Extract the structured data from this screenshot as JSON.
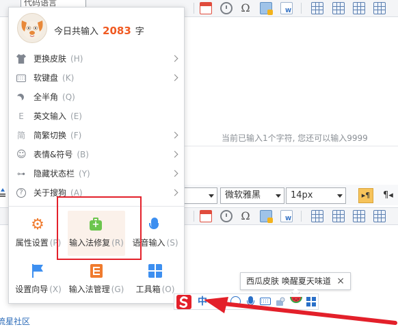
{
  "editor": {
    "top_tab_label": "代码语言",
    "char_count_text": "当前已输入1个字符, 您还可以输入9999",
    "font_family": "微软雅黑",
    "font_size": "14px",
    "bottom_link": "流星社区"
  },
  "ime_menu": {
    "header": {
      "prefix": "今日共输入",
      "count": "2083",
      "suffix": "字"
    },
    "items": [
      {
        "label": "更换皮肤",
        "key": "(H)",
        "icon": "tshirt-icon",
        "submenu": true
      },
      {
        "label": "软键盘",
        "key": "(K)",
        "icon": "keyboard-icon",
        "submenu": true
      },
      {
        "label": "全半角",
        "key": "(Q)",
        "icon": "moon-icon",
        "submenu": false
      },
      {
        "label": "英文输入",
        "key": "(E)",
        "icon": "english-icon",
        "glyph": "E",
        "submenu": false
      },
      {
        "label": "简繁切换",
        "key": "(F)",
        "icon": "simplified-traditional-icon",
        "glyph": "简",
        "submenu": true
      },
      {
        "label": "表情&符号",
        "key": "(B)",
        "icon": "smiley-icon",
        "glyph": "☺",
        "submenu": true
      },
      {
        "label": "隐藏状态栏",
        "key": "(Y)",
        "icon": "hide-statusbar-icon",
        "glyph": "⊶",
        "submenu": true
      },
      {
        "label": "关于搜狗",
        "key": "(A)",
        "icon": "help-icon",
        "glyph": "?",
        "submenu": true
      }
    ],
    "tiles": [
      {
        "label": "属性设置",
        "key": "(P)",
        "icon": "gear-icon"
      },
      {
        "label": "输入法修复",
        "key": "(R)",
        "icon": "repair-briefcase-icon"
      },
      {
        "label": "语音输入",
        "key": "(S)",
        "icon": "microphone-icon"
      },
      {
        "label": "设置向导",
        "key": "(X)",
        "icon": "flag-icon"
      },
      {
        "label": "输入法管理",
        "key": "(G)",
        "icon": "manage-icon"
      },
      {
        "label": "工具箱",
        "key": "(O)",
        "icon": "toolbox-icon"
      }
    ]
  },
  "status_bar": {
    "mode": "中",
    "punct": "•,"
  },
  "tooltip": {
    "text": "西瓜皮肤 唤醒夏天味道",
    "close": "×"
  },
  "colors": {
    "accent_orange": "#f05a22",
    "highlight_red": "#e3202a",
    "sogou_red": "#e3202a",
    "blue": "#2a70c8"
  }
}
